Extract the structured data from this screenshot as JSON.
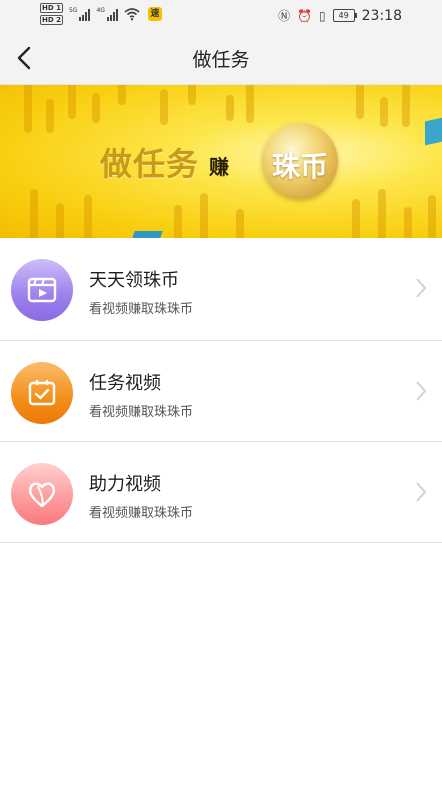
{
  "status_bar": {
    "hd_top": "HD 1",
    "hd_bottom": "HD 2",
    "sim1_label": "5G",
    "sim2_label": "4G",
    "app_badge": "速",
    "battery": "49",
    "time": "23:18",
    "icons": [
      "nfc-icon",
      "alarm-icon",
      "vibrate-icon",
      "battery-icon",
      "wifi-icon",
      "signal-icon"
    ]
  },
  "header": {
    "title": "做任务",
    "back_icon": "chevron-left-icon"
  },
  "banner": {
    "text_main": "做任务",
    "text_mid": "赚",
    "coin_text": "珠币",
    "colors": {
      "bg": "#f9cf11",
      "text": "#c89a1a",
      "coin": "#d5a43b"
    }
  },
  "tasks": [
    {
      "title": "天天领珠币",
      "subtitle": "看视频赚取珠珠币",
      "icon": "video-play-icon",
      "colors": [
        "#c9b8f6",
        "#8d6fe8"
      ]
    },
    {
      "title": "任务视频",
      "subtitle": "看视频赚取珠珠币",
      "icon": "checkbox-check-icon",
      "colors": [
        "#fbb35c",
        "#ef7f08"
      ]
    },
    {
      "title": "助力视频",
      "subtitle": "看视频赚取珠珠币",
      "icon": "heart-icon",
      "colors": [
        "#ffc3c3",
        "#fb7f83"
      ]
    }
  ]
}
